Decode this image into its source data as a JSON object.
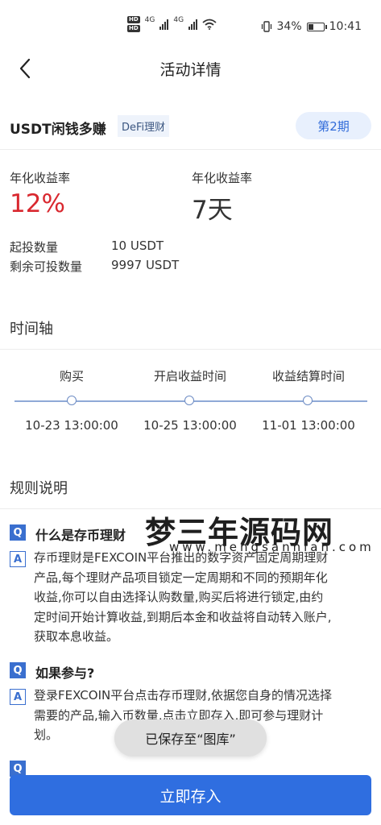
{
  "status_bar": {
    "hd_badges": [
      "HD",
      "HD"
    ],
    "signal_labels": [
      "4G",
      "4G"
    ],
    "battery_percent": "34%",
    "battery_level": 0.34,
    "time": "10:41",
    "icons": [
      "signal-icon",
      "wifi-icon",
      "vibrate-icon",
      "battery-icon"
    ]
  },
  "nav": {
    "title": "活动详情",
    "back_icon": "chevron-left-icon"
  },
  "product": {
    "name": "USDT闲钱多赚",
    "tag": "DeFi理财",
    "period": "第2期"
  },
  "rates": {
    "left_label": "年化收益率",
    "left_value": "12%",
    "right_label": "年化收益率",
    "right_value": "7天"
  },
  "investment": {
    "min_label": "起投数量",
    "min_value": "10 USDT",
    "remaining_label": "剩余可投数量",
    "remaining_value": "9997 USDT"
  },
  "timeline": {
    "title": "时间轴",
    "points": [
      {
        "label": "购买",
        "date": "10-23 13:00:00"
      },
      {
        "label": "开启收益时间",
        "date": "10-25 13:00:00"
      },
      {
        "label": "收益结算时间",
        "date": "11-01 13:00:00"
      }
    ]
  },
  "rules": {
    "title": "规则说明",
    "q_badge": "Q",
    "a_badge": "A",
    "items": [
      {
        "q": "什么是存币理财",
        "a_lines": [
          "存币理财是FEXCOIN平台推出的数字资产固定周期理财",
          "产品,每个理财产品项目锁定一定周期和不同的预期年化",
          "收益,你可以自由选择认购数量,购买后将进行锁定,由约",
          "定时间开始计算收益,到期后本金和收益将自动转入账户,",
          "获取本息收益。"
        ]
      },
      {
        "q": "如果参与?",
        "a_lines": [
          "登录FEXCOIN平台点击存币理财,依据您自身的情况选择",
          "需要的产品,输入币数量,点击立即存入,即可参与理财计",
          "划。"
        ]
      }
    ]
  },
  "watermark": {
    "text": "梦三年源码网",
    "url": "www.mengsannian.com"
  },
  "toast": "已保存至“图库”",
  "cta_label": "立即存入",
  "colors": {
    "accent": "#2f6ee0",
    "rate_red": "#d9282f",
    "period_bg": "#e8f0fd"
  }
}
